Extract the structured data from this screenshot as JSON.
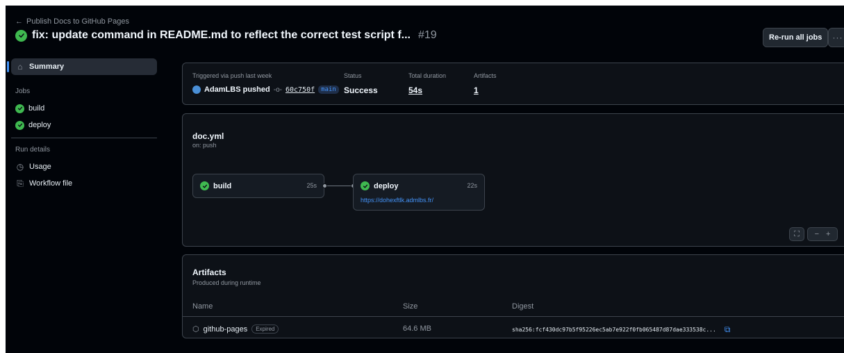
{
  "header": {
    "back_label": "Publish Docs to GitHub Pages",
    "title": "fix: update command in README.md to reflect the correct test script f...",
    "run_number": "#19",
    "rerun_label": "Re-run all jobs",
    "more_label": "···"
  },
  "sidebar": {
    "summary": "Summary",
    "jobs_heading": "Jobs",
    "jobs": [
      {
        "label": "build"
      },
      {
        "label": "deploy"
      }
    ],
    "run_details_heading": "Run details",
    "usage": "Usage",
    "workflow_file": "Workflow file"
  },
  "summary": {
    "trigger_label": "Triggered via push last week",
    "actor": "AdamLBS pushed",
    "commit_sha": "60c750f",
    "branch": "main",
    "status_label": "Status",
    "status_value": "Success",
    "duration_label": "Total duration",
    "duration_value": "54s",
    "artifacts_label": "Artifacts",
    "artifacts_value": "1"
  },
  "workflow": {
    "name": "doc.yml",
    "trigger": "on: push",
    "jobs": [
      {
        "name": "build",
        "duration": "25s"
      },
      {
        "name": "deploy",
        "duration": "22s",
        "url": "https://dohexftlk.admlbs.fr/"
      }
    ],
    "zoom_out": "−",
    "zoom_in": "+"
  },
  "artifacts": {
    "title": "Artifacts",
    "subtitle": "Produced during runtime",
    "columns": [
      "Name",
      "Size",
      "Digest"
    ],
    "rows": [
      {
        "name": "github-pages",
        "badge": "Expired",
        "size": "64.6 MB",
        "digest": "sha256:fcf430dc97b5f95226ec5ab7e922f0fb065487d87dae333538c..."
      }
    ]
  },
  "colors": {
    "background": "#010409",
    "card": "#0d1117",
    "border": "#3d444d",
    "success": "#3fb950",
    "accent": "#4493f8"
  }
}
